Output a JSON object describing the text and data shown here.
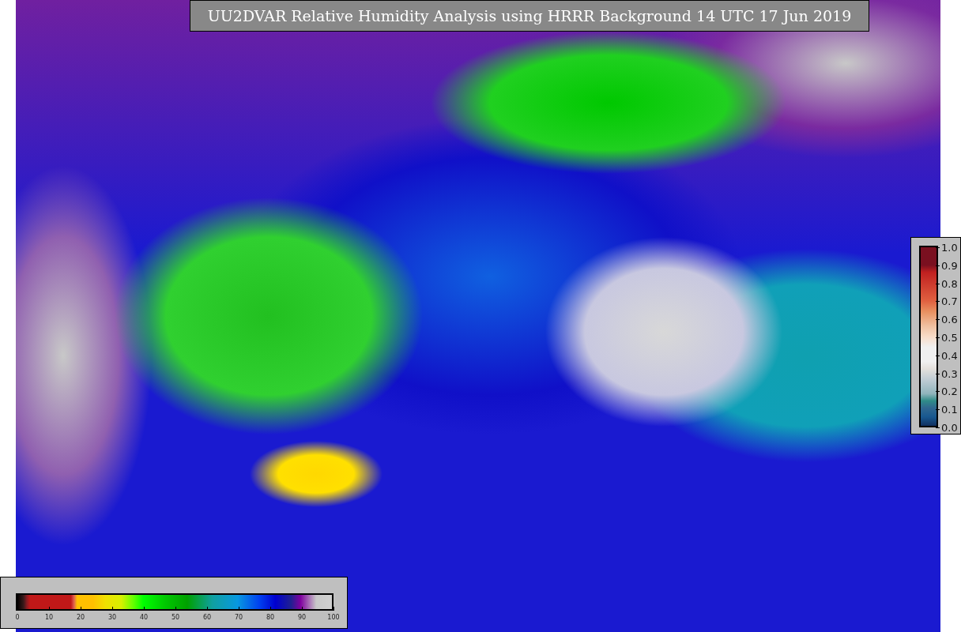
{
  "title": "UU2DVAR Relative Humidity Analysis using HRRR Background 14 UTC 17 Jun 2019",
  "humidity_colorbar": {
    "ticks": [
      "0",
      "10",
      "20",
      "30",
      "40",
      "50",
      "60",
      "70",
      "80",
      "90",
      "100"
    ]
  },
  "marker_colorbar": {
    "ticks": [
      "1.0",
      "0.9",
      "0.8",
      "0.7",
      "0.6",
      "0.5",
      "0.4",
      "0.3",
      "0.2",
      "0.1",
      "0.0"
    ]
  }
}
